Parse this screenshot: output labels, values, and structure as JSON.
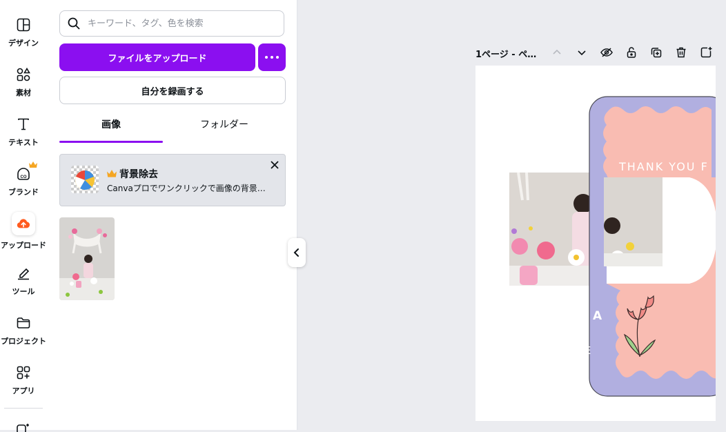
{
  "rail": {
    "items": [
      {
        "label": "デザイン"
      },
      {
        "label": "素材"
      },
      {
        "label": "テキスト"
      },
      {
        "label": "ブランド"
      },
      {
        "label": "アップロード"
      },
      {
        "label": "ツール"
      },
      {
        "label": "プロジェクト"
      },
      {
        "label": "アプリ"
      }
    ]
  },
  "panel": {
    "search_placeholder": "キーワード、タグ、色を検索",
    "upload_label": "ファイルをアップロード",
    "record_label": "自分を録画する",
    "tabs": [
      {
        "label": "画像",
        "active": true
      },
      {
        "label": "フォルダー",
        "active": false
      }
    ],
    "promo": {
      "title": "背景除去",
      "text": "Canvaプロでワンクリックで画像の背景を…"
    }
  },
  "canvas": {
    "page_label": "1ページ - ペ…",
    "design_text_1": "THANK YOU F",
    "design_text_2": "A",
    "design_text_3": "E"
  },
  "colors": {
    "accent": "#8b0ff0",
    "card_lavender": "#b1afe0",
    "card_pink": "#f9bcb2",
    "crown": "#f5a623"
  }
}
